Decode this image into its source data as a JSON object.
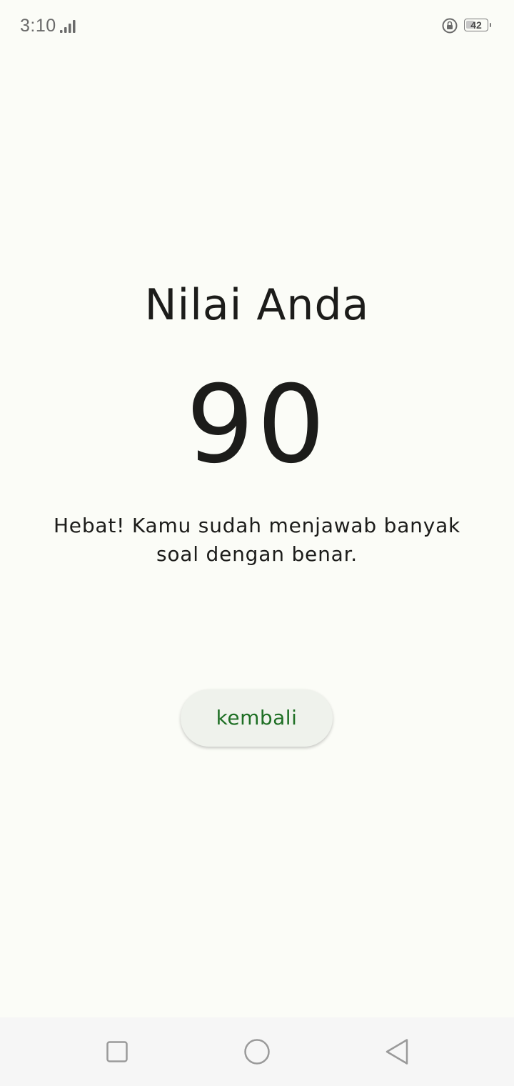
{
  "status_bar": {
    "time": "3:10",
    "signal_icon": "signal-bars-icon",
    "rotation_lock_icon": "rotation-lock-icon",
    "battery_level": "42",
    "battery_percent": 42
  },
  "result": {
    "title": "Nilai Anda",
    "score": "90",
    "message": "Hebat! Kamu sudah menjawab banyak soal dengan benar."
  },
  "actions": {
    "back_label": "kembali"
  },
  "nav_bar": {
    "recents_icon": "square-recents-icon",
    "home_icon": "circle-home-icon",
    "back_icon": "triangle-back-icon"
  },
  "colors": {
    "background": "#fbfcf7",
    "accent": "#1e6f24",
    "button_bg": "#eff2ec",
    "text": "#1c1c1a"
  }
}
